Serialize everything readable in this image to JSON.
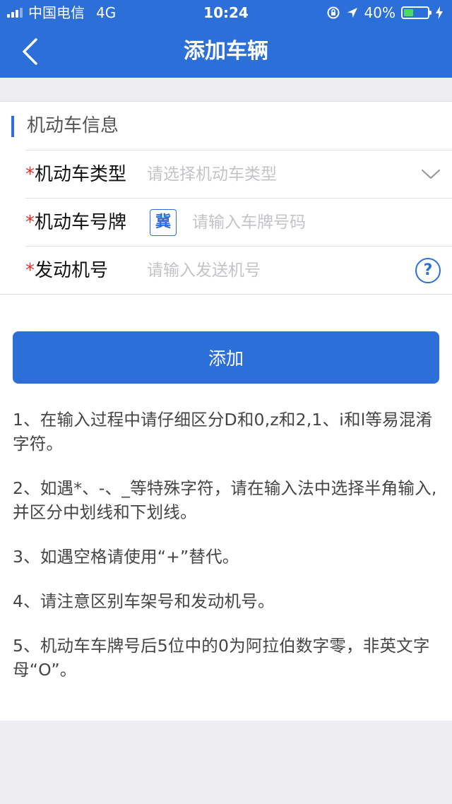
{
  "status_bar": {
    "carrier": "中国电信",
    "network": "4G",
    "time": "10:24",
    "battery_text": "40%",
    "battery_level": 0.4
  },
  "nav": {
    "title": "添加车辆",
    "back_icon": "chevron-left-icon"
  },
  "form": {
    "section_title": "机动车信息",
    "required_mark": "*",
    "vehicle_type": {
      "label": "机动车类型",
      "placeholder": "请选择机动车类型",
      "icon": "chevron-down-icon"
    },
    "plate": {
      "label": "机动车号牌",
      "province": "冀",
      "placeholder": "请输入车牌号码"
    },
    "engine": {
      "label": "发动机号",
      "placeholder": "请输入发送机号",
      "help_text": "?",
      "icon": "help-icon"
    }
  },
  "actions": {
    "add_label": "添加"
  },
  "notes": [
    "1、在输入过程中请仔细区分D和0,z和2,1、i和l等易混淆字符。",
    "2、如遇*、-、_等特殊字符，请在输入法中选择半角输入,并区分中划线和下划线。",
    "3、如遇空格请使用“+”替代。",
    "4、请注意区别车架号和发动机号。",
    "5、机动车车牌号后5位中的0为阿拉伯数字零，非英文字母“O”。"
  ],
  "colors": {
    "primary": "#2d6fd8",
    "required": "#e03030",
    "background": "#eeeef2",
    "battery": "#4cd964"
  }
}
